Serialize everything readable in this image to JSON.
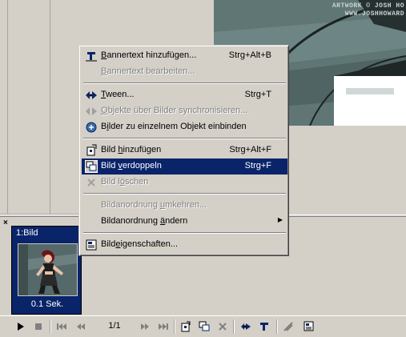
{
  "canvas": {
    "credit_line1": "ARTWORK © JOSH HO",
    "credit_line2": "WWW.JOSHHOWARD"
  },
  "frames_panel": {
    "close_label": "×",
    "frame": {
      "title": "1:Bild",
      "duration": "0.1 Sek."
    }
  },
  "toolbar": {
    "counter": "1/1"
  },
  "menu": {
    "items": [
      {
        "pre": "",
        "u": "B",
        "post": "annertext hinzufügen...",
        "shortcut": "Strg+Alt+B",
        "icon": "banner-text-icon",
        "disabled": false
      },
      {
        "pre": "",
        "u": "B",
        "post": "annertext bearbeiten...",
        "shortcut": "",
        "icon": "",
        "disabled": true
      },
      {
        "pre": "",
        "u": "T",
        "post": "ween...",
        "shortcut": "Strg+T",
        "icon": "tween-icon",
        "disabled": false
      },
      {
        "pre": "",
        "u": "O",
        "post": "bjekte über Bilder synchronisieren...",
        "shortcut": "",
        "icon": "sync-objects-icon",
        "disabled": true
      },
      {
        "pre": "B",
        "u": "i",
        "post": "lder zu einzelnem Objekt einbinden",
        "shortcut": "",
        "icon": "embed-frames-icon",
        "disabled": false
      },
      {
        "pre": "Bild ",
        "u": "h",
        "post": "inzufügen",
        "shortcut": "Strg+Alt+F",
        "icon": "add-frame-icon",
        "disabled": false
      },
      {
        "pre": "Bild ",
        "u": "v",
        "post": "erdoppeln",
        "shortcut": "Strg+F",
        "icon": "duplicate-frame-icon",
        "disabled": false
      },
      {
        "pre": "Bild l",
        "u": "ö",
        "post": "schen",
        "shortcut": "",
        "icon": "delete-frame-icon",
        "disabled": true
      },
      {
        "pre": "Bildanordnung ",
        "u": "u",
        "post": "mkehren...",
        "shortcut": "",
        "icon": "",
        "disabled": true
      },
      {
        "pre": "Bildanordnung ",
        "u": "ä",
        "post": "ndern",
        "shortcut": "",
        "icon": "",
        "disabled": false,
        "submenu_arrow": "▶"
      },
      {
        "pre": "Bild",
        "u": "e",
        "post": "igenschaften...",
        "shortcut": "",
        "icon": "frame-properties-icon",
        "disabled": false
      }
    ],
    "selected_index": 6
  },
  "colors": {
    "menu_highlight": "#0a246a",
    "face": "#d4d0c8",
    "disabled_text": "#808080"
  }
}
